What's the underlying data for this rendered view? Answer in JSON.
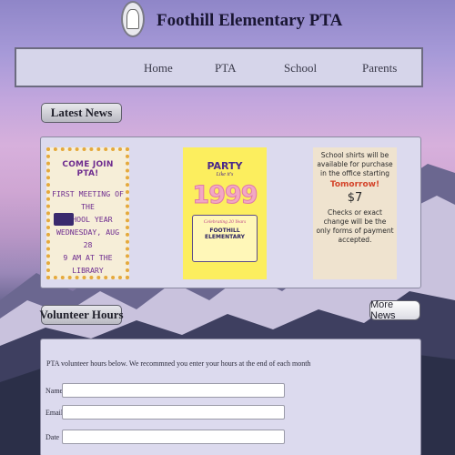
{
  "header": {
    "title": "Foothill Elementary PTA",
    "logo_icon": "school-seal-icon"
  },
  "nav": {
    "items": [
      {
        "label": "Home"
      },
      {
        "label": "PTA"
      },
      {
        "label": "School"
      },
      {
        "label": "Parents"
      }
    ]
  },
  "latest_news": {
    "heading": "Latest News",
    "cards": [
      {
        "title": "COME JOIN PTA!",
        "lines": [
          "FIRST MEETING OF THE",
          "SCHOOL YEAR",
          "WEDNESDAY, AUG 28",
          "9 AM AT THE LIBRARY"
        ]
      },
      {
        "title": "PARTY",
        "subtitle": "Like it's",
        "year": "1999",
        "tagline": "Celebrating 20 Years",
        "school": "FOOTHILL ELEMENTARY"
      },
      {
        "text1": "School shirts will be available for purchase in the office starting",
        "highlight": "Tomorrow!",
        "price": "$7",
        "text2": "Checks or exact change will be the only forms of payment accepted."
      }
    ],
    "more_button": "More News"
  },
  "volunteer": {
    "heading": "Volunteer Hours",
    "intro": "PTA volunteer hours below. We recommned you enter your hours at the end of each month",
    "fields": [
      {
        "label": "Name",
        "value": ""
      },
      {
        "label": "Email",
        "value": ""
      },
      {
        "label": "Date",
        "value": ""
      }
    ]
  },
  "colors": {
    "panel": "#dcdaee",
    "title": "#1a1633",
    "accent_purple": "#6e2c8f"
  }
}
